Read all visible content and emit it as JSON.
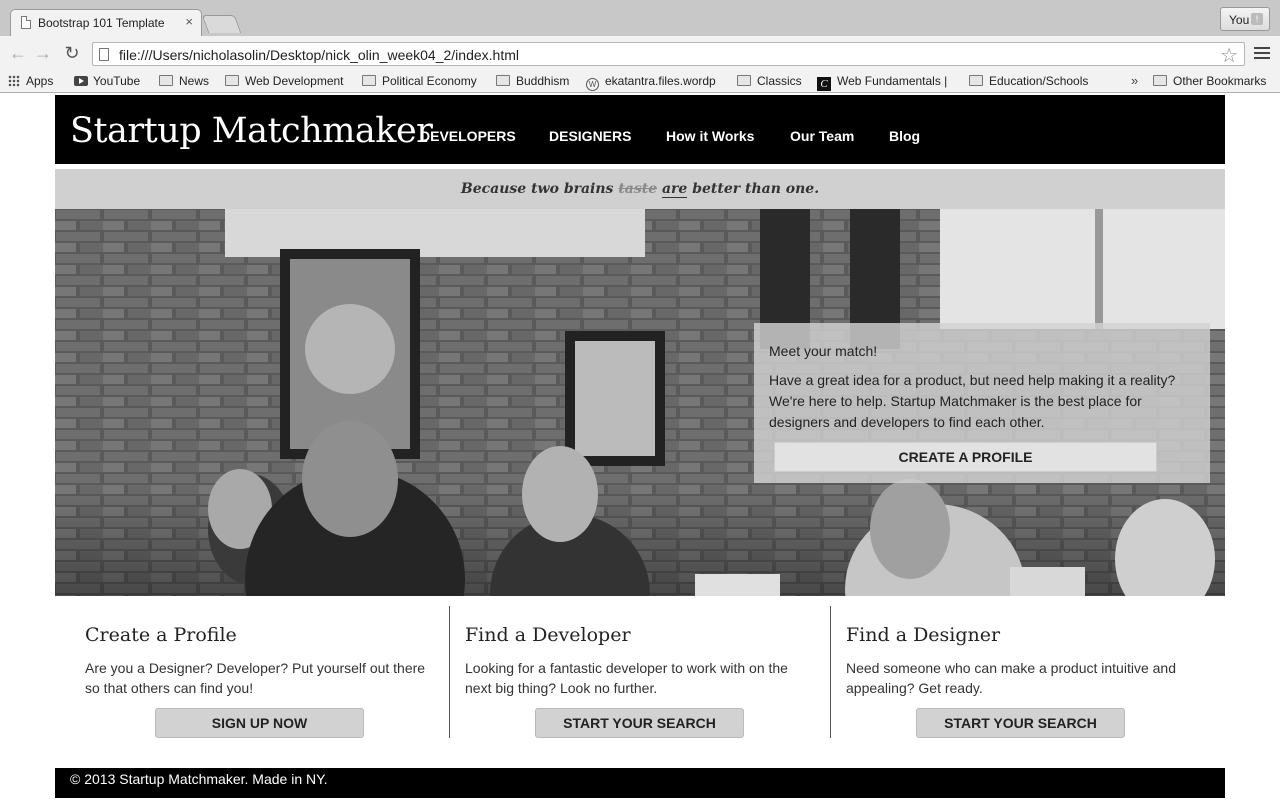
{
  "browser": {
    "tab_title": "Bootstrap 101 Template",
    "tab_close": "×",
    "profile_label": "You",
    "url": "file:///Users/nicholasolin/Desktop/nick_olin_week04_2/index.html",
    "bookmarks": [
      "Apps",
      "YouTube",
      "News",
      "Web Development",
      "Political Economy",
      "Buddhism",
      "ekatantra.files.wordp",
      "Classics",
      "Web Fundamentals |",
      "Education/Schools"
    ],
    "bookmarks_more": "»",
    "other_bookmarks": "Other Bookmarks"
  },
  "site": {
    "brand": "Startup Matchmaker",
    "nav": [
      "DEVELOPERS",
      "DESIGNERS",
      "How it Works",
      "Our Team",
      "Blog"
    ],
    "tagline": {
      "before": "Because two brains",
      "struck": "taste",
      "underlined": "are",
      "after": "better than one."
    },
    "hero": {
      "title": "Meet your match!",
      "text": "Have a great idea for a product, but need help making it a reality? We're here to help. Startup Matchmaker is the best place for designers and developers to find each other.",
      "cta": "CREATE A PROFILE"
    },
    "features": [
      {
        "title": "Create a Profile",
        "text": "Are you a Designer? Developer? Put yourself out there so that others can find you!",
        "button": "SIGN UP NOW"
      },
      {
        "title": "Find a Developer",
        "text": "Looking for a fantastic developer to work with on the next big thing? Look no further.",
        "button": "START YOUR SEARCH"
      },
      {
        "title": "Find a Designer",
        "text": "Need someone who can make a product intuitive and appealing? Get ready.",
        "button": "START YOUR SEARCH"
      }
    ],
    "footer": "© 2013 Startup Matchmaker. Made in NY."
  }
}
